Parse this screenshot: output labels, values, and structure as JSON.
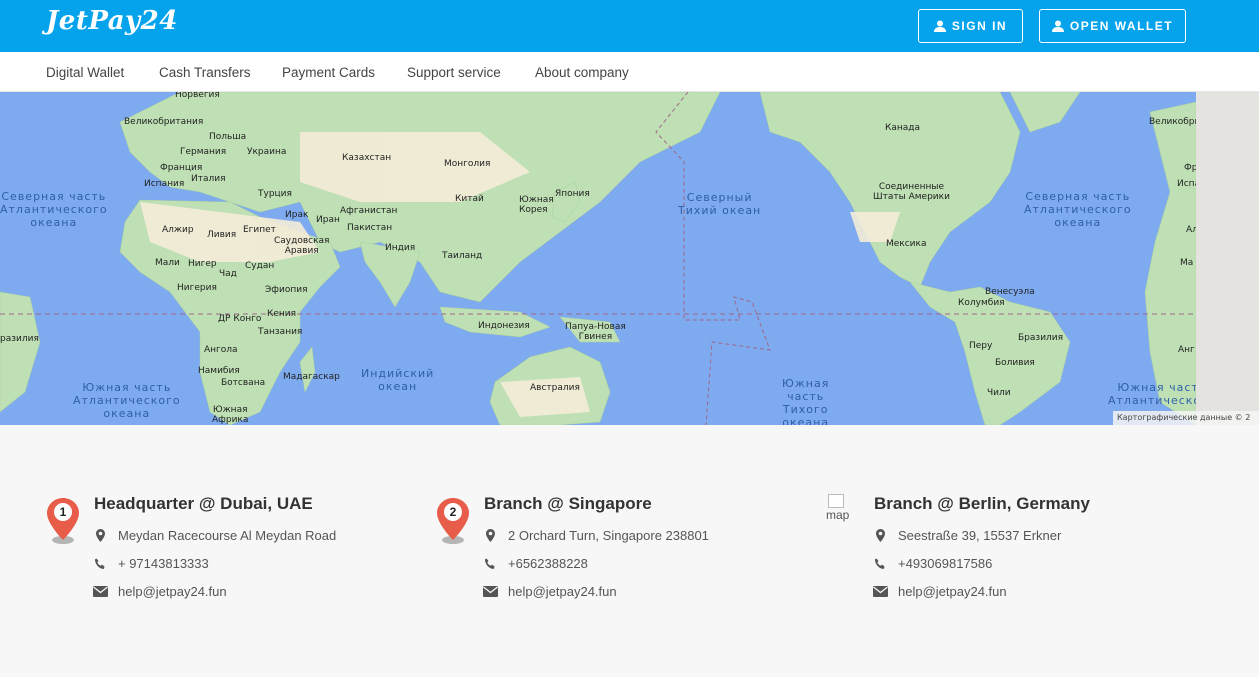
{
  "header": {
    "logo": "JetPay24",
    "sign_in": "SIGN IN",
    "open_wallet": "OPEN WALLET"
  },
  "nav": [
    "Digital Wallet",
    "Cash Transfers",
    "Payment Cards",
    "Support service",
    "About company"
  ],
  "map": {
    "credit": "Картографические данные © 2",
    "oceans": {
      "north_atlantic_w": "Северная часть\nАтлантического\nокеана",
      "north_pacific": "Северный\nТихий океан",
      "north_atlantic_e": "Северная часть\nАтлантического\nокеана",
      "south_atlantic_w": "Южная часть\nАтлантического\nокеана",
      "indian": "Индийский\nокеан",
      "south_pacific": "Южная\nчасть\nТихого\nокеана",
      "south_atlantic_e": "Южная часть\nАтлантического"
    },
    "countries": {
      "norway": "Норвегия",
      "uk": "Великобритания",
      "poland": "Польша",
      "germany": "Германия",
      "ukraine": "Украина",
      "france": "Франция",
      "italy": "Италия",
      "spain": "Испания",
      "kazakhstan": "Казахстан",
      "mongolia": "Монголия",
      "turkey": "Турция",
      "iraq": "Ирак",
      "iran": "Иран",
      "afghanistan": "Афганистан",
      "china": "Китай",
      "japan": "Япония",
      "korea": "Южная\nКорея",
      "algeria": "Алжир",
      "libya": "Ливия",
      "egypt": "Египет",
      "saudi": "Саудовская\nАравия",
      "pakistan": "Пакистан",
      "india": "Индия",
      "thailand": "Таиланд",
      "mali": "Мали",
      "niger": "Нигер",
      "chad": "Чад",
      "sudan": "Судан",
      "nigeria": "Нигерия",
      "ethiopia": "Эфиопия",
      "drc": "ДР Конго",
      "kenya": "Кения",
      "tanzania": "Танзания",
      "indonesia": "Индонезия",
      "png": "Папуа-Новая\nГвинея",
      "angola": "Ангола",
      "namibia": "Намибия",
      "botswana": "Ботсвана",
      "madagascar": "Мадагаскар",
      "south_africa": "Южная\nАфрика",
      "australia": "Австралия",
      "canada": "Канада",
      "usa": "Соединенные\nШтаты Америки",
      "mexico": "Мексика",
      "venezuela": "Венесуэла",
      "colombia": "Колумбия",
      "peru": "Перу",
      "brazil": "Бразилия",
      "bolivia": "Боливия",
      "chile": "Чили",
      "uk_e": "Великобри",
      "brazil_w": "разилия",
      "fr_e": "Фр",
      "isp_e": "Испа",
      "al_e": "Ал",
      "ma_e": "Ма",
      "ang_e": "Анг"
    }
  },
  "offices": [
    {
      "number": "1",
      "title": "Headquarter @ Dubai, UAE",
      "address": "Meydan Racecourse Al Meydan Road",
      "phone": "+ 97143813333",
      "email": "help@jetpay24.fun"
    },
    {
      "number": "2",
      "title": "Branch @ Singapore",
      "address": "2 Orchard Turn, Singapore 238801",
      "phone": "+6562388228",
      "email": "help@jetpay24.fun"
    },
    {
      "img_alt": "map",
      "title": "Branch @ Berlin, Germany",
      "address": "Seestraße 39, 15537 Erkner",
      "phone": "+493069817586",
      "email": "help@jetpay24.fun"
    }
  ],
  "colors": {
    "brand": "#04a3ec",
    "pin": "#e85c4a",
    "ocean": "#7eaaf0",
    "land": "#bfe0b4"
  }
}
